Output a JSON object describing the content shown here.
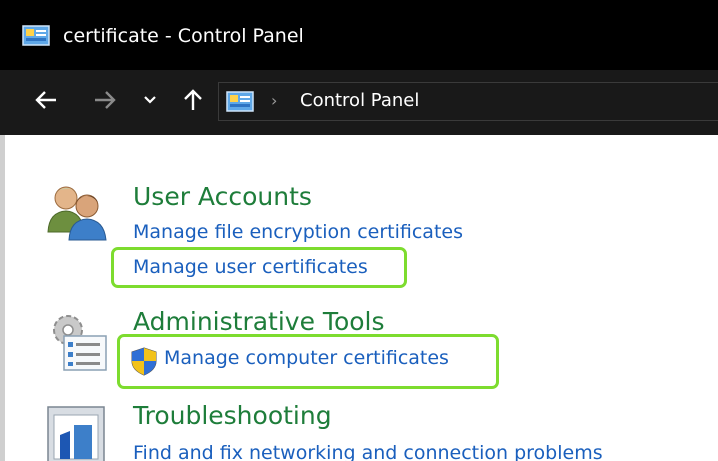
{
  "window": {
    "title": "certificate - Control Panel"
  },
  "nav": {
    "breadcrumb_separator": "›",
    "address": "Control Panel"
  },
  "categories": [
    {
      "title": "User Accounts",
      "icon": "users-icon",
      "links": [
        "Manage file encryption certificates",
        "Manage user certificates"
      ]
    },
    {
      "title": "Administrative Tools",
      "icon": "admin-tools-icon",
      "links": [
        "Manage computer certificates"
      ]
    },
    {
      "title": "Troubleshooting",
      "icon": "troubleshooting-icon",
      "links": [
        "Find and fix networking and connection problems"
      ]
    }
  ],
  "colors": {
    "category_title": "#1e7d3a",
    "link": "#1a5fbd",
    "highlight": "#7ddc2f",
    "titlebar": "#000000",
    "navbar": "#191919"
  }
}
